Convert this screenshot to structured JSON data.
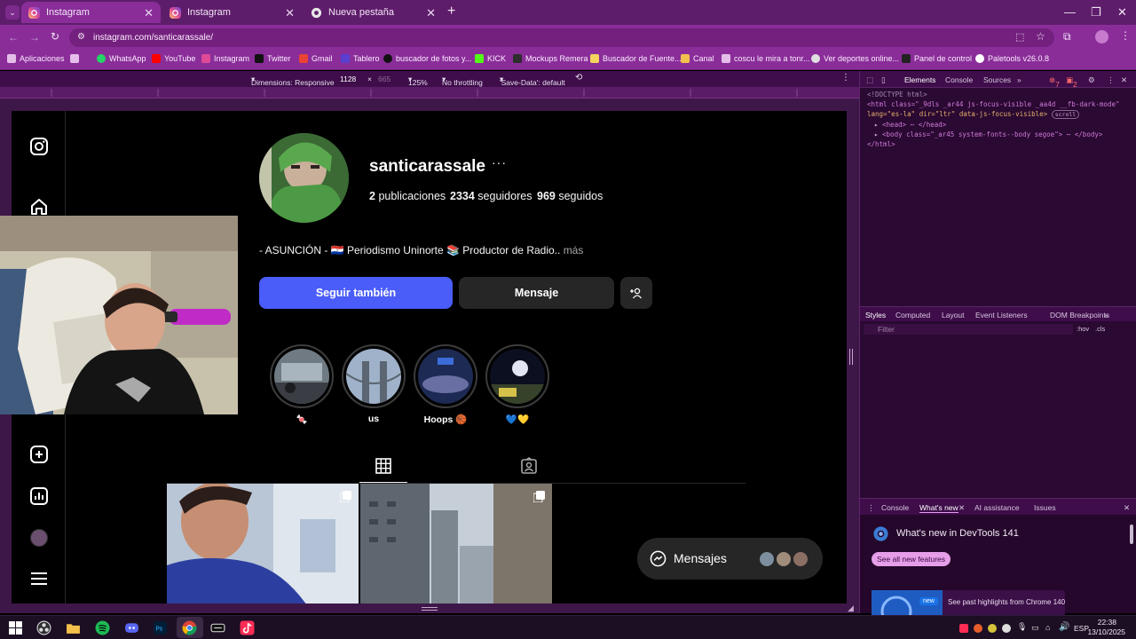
{
  "browser": {
    "tabs": [
      {
        "label": "Instagram",
        "active": true
      },
      {
        "label": "Instagram",
        "active": false
      },
      {
        "label": "Nueva pestaña",
        "active": false
      }
    ],
    "url": "instagram.com/santicarassale/",
    "bookmarks": [
      "Aplicaciones",
      "WhatsApp",
      "YouTube",
      "Instagram",
      "Twitter",
      "Gmail",
      "Tablero",
      "buscador de fotos y...",
      "KICK",
      "Mockups Remera",
      "Buscador de Fuente...",
      "Canal",
      "coscu le mira a tonr...",
      "Ver deportes online...",
      "Panel de control",
      "Paletools v26.0.8"
    ],
    "colors": {
      "frame": "#5e1d6b",
      "toolbar": "#8a2d99"
    }
  },
  "emulation": {
    "dimensions_label": "Dimensions: Responsive",
    "width": "1128",
    "times": "×",
    "height": "665",
    "zoom": "125%",
    "throttling": "No throttling",
    "save_data": "'Save-Data': default"
  },
  "profile": {
    "username": "santicarassale",
    "more": "···",
    "posts_count": "2",
    "posts_label": "publicaciones",
    "followers_count": "2334",
    "followers_label": "seguidores",
    "following_count": "969",
    "following_label": "seguidos",
    "bio": "- ASUNCIÓN - 🇵🇾 Periodismo Uninorte 📚 Productor de Radio..",
    "bio_more": "más",
    "follow_label": "Seguir también",
    "message_label": "Mensaje",
    "highlights": [
      {
        "label": "🍬"
      },
      {
        "label": "us"
      },
      {
        "label": "Hoops 🏀"
      },
      {
        "label": "💙💛"
      }
    ],
    "accent": "#4a5df9"
  },
  "messages": {
    "label": "Mensajes"
  },
  "devtools": {
    "tabs": [
      "Elements",
      "Console",
      "Sources"
    ],
    "errors": "7",
    "warnings": "2",
    "code_lines": [
      "<!DOCTYPE html>",
      "<html class=\"_9dls _ar44 js-focus-visible _aa4d __fb-dark-mode\"",
      "lang=\"es-la\" dir=\"ltr\" data-js-focus-visible>",
      "<head> ⋯ </head>",
      "<body class=\"_ar45 system-fonts--body segoe\"> ⋯ </body>",
      "</html>"
    ],
    "scroll_badge": "scroll",
    "subtabs": [
      "Styles",
      "Computed",
      "Layout",
      "Event Listeners",
      "DOM Breakpoints"
    ],
    "filter_placeholder": "Filter",
    "hov": ":hov",
    "cls": ".cls",
    "drawer_tabs": [
      "Console",
      "What's new",
      "AI assistance",
      "Issues"
    ],
    "whats_new_title": "What's new in DevTools 141",
    "see_all": "See all new features",
    "new_badge": "new",
    "past_highlights": "See past highlights from Chrome 140"
  },
  "taskbar": {
    "lang": "ESP",
    "time": "22:38",
    "date": "13/10/2025"
  }
}
